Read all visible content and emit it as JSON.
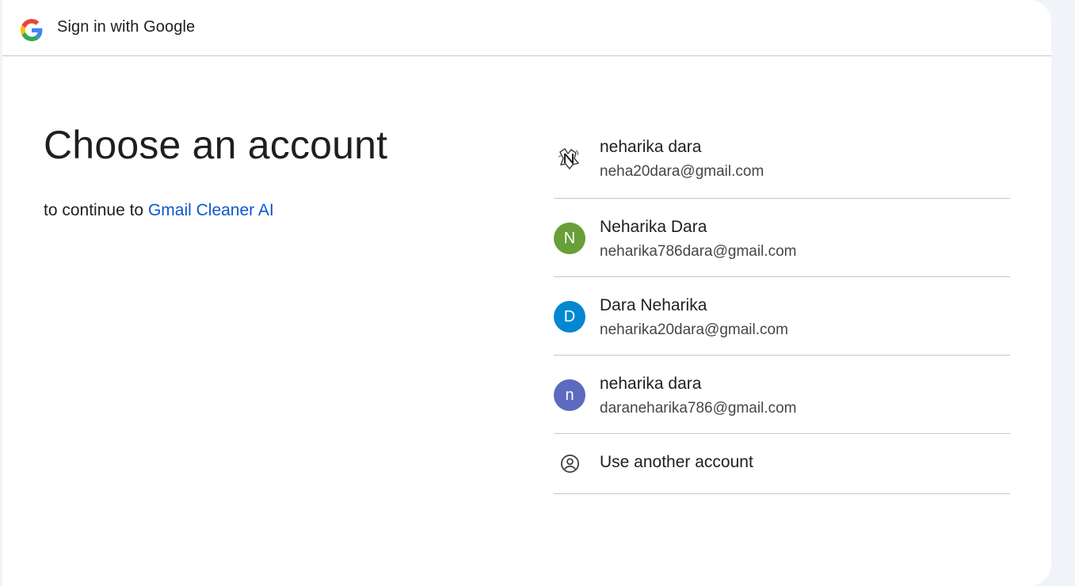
{
  "header": {
    "title": "Sign in with Google",
    "logo_icon": "google-g-icon"
  },
  "main": {
    "headline": "Choose an account",
    "subtitle_prefix": "to continue to",
    "app_name": "Gmail Cleaner AI"
  },
  "accounts": [
    {
      "name": "neharika dara",
      "email": "neha20dara@gmail.com",
      "avatar_type": "photo",
      "avatar_letter": "",
      "avatar_color": "#ffffff"
    },
    {
      "name": "Neharika Dara",
      "email": "neharika786dara@gmail.com",
      "avatar_type": "letter",
      "avatar_letter": "N",
      "avatar_color": "#689f38"
    },
    {
      "name": "Dara Neharika",
      "email": "neharika20dara@gmail.com",
      "avatar_type": "letter",
      "avatar_letter": "D",
      "avatar_color": "#0288d1"
    },
    {
      "name": "neharika dara",
      "email": "daraneharika786@gmail.com",
      "avatar_type": "letter",
      "avatar_letter": "n",
      "avatar_color": "#5c6bc0"
    }
  ],
  "use_another": {
    "label": "Use another account",
    "icon": "account-circle-icon"
  },
  "colors": {
    "link": "#0b57d0",
    "background": "#f0f4f9",
    "divider": "#c4c7c5"
  }
}
